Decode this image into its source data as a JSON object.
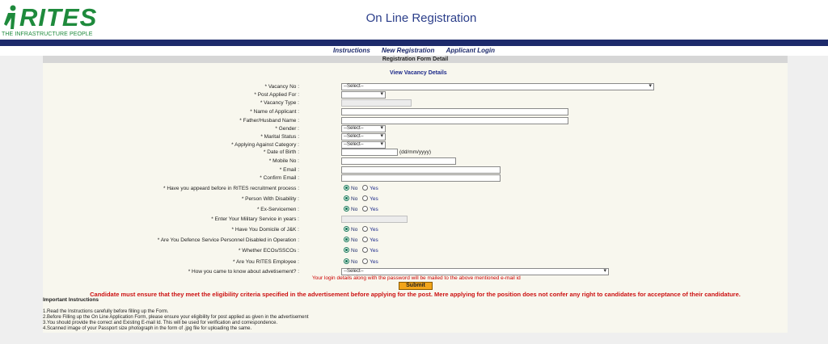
{
  "header": {
    "logo_word": "RITES",
    "logo_tagline": "THE INFRASTRUCTURE PEOPLE",
    "title": "On Line Registration"
  },
  "nav": {
    "items": [
      "Instructions",
      "New Registration",
      "Applicant Login"
    ]
  },
  "form": {
    "header": "Registration Form Detail",
    "vacancy_link": "View Vacancy Details",
    "fields": {
      "vacancy_no": {
        "label": "* Vacancy No :",
        "value": "--Select--"
      },
      "post_applied": {
        "label": "* Post Applied For :",
        "value": ""
      },
      "vacancy_type": {
        "label": "* Vacancy Type :",
        "value": ""
      },
      "name": {
        "label": "* Name of Applicant :",
        "value": ""
      },
      "father_name": {
        "label": "* Father/Husband Name :",
        "value": ""
      },
      "gender": {
        "label": "* Gender :",
        "value": "--Select--"
      },
      "marital": {
        "label": "* Marital Status :",
        "value": "--Select--"
      },
      "category": {
        "label": "* Applying Against Category :",
        "value": "--Select--"
      },
      "dob": {
        "label": "* Date of Birth :",
        "value": "",
        "hint": "(dd/mm/yyyy)"
      },
      "mobile": {
        "label": "* Mobile No :",
        "value": ""
      },
      "email": {
        "label": "* Email :",
        "value": ""
      },
      "confirm_email": {
        "label": "* Confirm Email :",
        "value": ""
      },
      "appeared_before": {
        "label": "* Have you appeard before in RITES recruitment process :",
        "selected": "No"
      },
      "disability": {
        "label": "* Person With Disability :",
        "selected": "No"
      },
      "ex_servicemen": {
        "label": "* Ex-Servicemen :",
        "selected": "No"
      },
      "military_years": {
        "label": "* Enter Your Military Service in years :",
        "value": ""
      },
      "domicile_jk": {
        "label": "* Have You Domicile of J&K :",
        "selected": "No"
      },
      "defence_disabled": {
        "label": "* Are You Defence Service Personnel Disabled in Operation :",
        "selected": "No"
      },
      "ecos_sscos": {
        "label": "* Whether ECOs/SSCOs :",
        "selected": "No"
      },
      "rites_employee": {
        "label": "* Are You RITES Employee :",
        "selected": "No"
      },
      "how_known": {
        "label": "* How you came to know about advetisement? :",
        "value": "--Select--"
      }
    },
    "radio_no": "No",
    "radio_yes": "Yes",
    "login_note": "Your login details along with the password will be mailed to the above mentioned e-mail id",
    "submit_label": "Submit",
    "warning": "Candidate must ensure that they meet the eligibility criteria specified in the advertisement before applying for the post. Mere applying for the position does not confer any right to candidates for acceptance of their candidature."
  },
  "instructions": {
    "title": "Important Instructions",
    "items": [
      "1.Read the Instructions carefully before filling up the Form.",
      "2.Before Filling up the On Line Application Form, please ensure your eligibility for post applied as given in the advertisement",
      "3.You should provide the correct and Existing E-mail Id. This will be used for verification and correspondence.",
      "4.Scanned image of your Passport size photograph in the form of .jpg file for uploading the same."
    ]
  },
  "colors": {
    "brand_green": "#1e8a3c",
    "navy": "#1d2a6b",
    "warning_red": "#cc1111",
    "submit_orange": "#f2a51a"
  }
}
